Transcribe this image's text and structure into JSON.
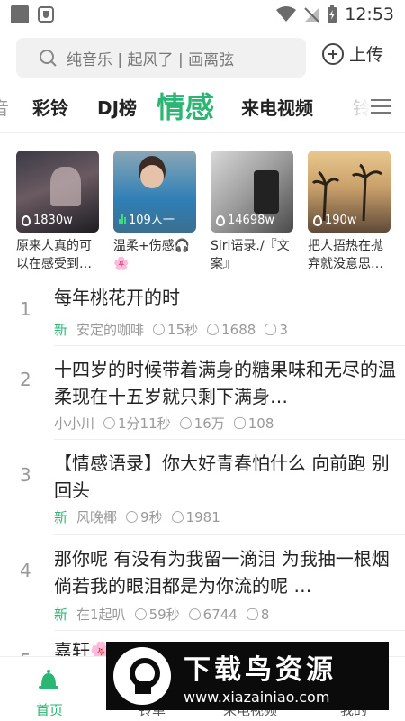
{
  "status": {
    "time": "12:53"
  },
  "search": {
    "placeholder": "纯音乐 | 起风了 | 画离弦",
    "upload_label": "上传"
  },
  "tabs": [
    {
      "label": "音"
    },
    {
      "label": "彩铃"
    },
    {
      "label": "DJ榜"
    },
    {
      "label": "情感",
      "active": true
    },
    {
      "label": "来电视频"
    },
    {
      "label": "铃"
    }
  ],
  "cards": [
    {
      "plays": "1830w",
      "title": "原来人真的可以在感受到…"
    },
    {
      "plays": "109人一",
      "title": "温柔+伤感🎧🌸"
    },
    {
      "plays": "14698w",
      "title": "Siri语录./『文案』"
    },
    {
      "plays": "190w",
      "title": "把人捂热在抛弃就没意思…"
    }
  ],
  "list": [
    {
      "rank": "1",
      "title": "每年桃花开的时",
      "is_new": true,
      "new_label": "新",
      "author": "安定的咖啡",
      "duration": "15秒",
      "likes": "1688",
      "comments": "3"
    },
    {
      "rank": "2",
      "title": "十四岁的时候带着满身的糖果味和无尽的温柔现在十五岁就只剩下满身…",
      "is_new": false,
      "new_label": "",
      "author": "小小川",
      "duration": "1分11秒",
      "likes": "16万",
      "comments": "108"
    },
    {
      "rank": "3",
      "title": "【情感语录】你大好青春怕什么 向前跑 别回头",
      "is_new": true,
      "new_label": "新",
      "author": "风晚椰",
      "duration": "9秒",
      "likes": "1981",
      "comments": ""
    },
    {
      "rank": "4",
      "title": "那你呢 有没有为我留一滴泪 为我抽一根烟 倘若我的眼泪都是为你流的呢 …",
      "is_new": true,
      "new_label": "新",
      "author": "在1起叭",
      "duration": "59秒",
      "likes": "6744",
      "comments": "8"
    },
    {
      "rank": "5",
      "title": "嘉轩🌸",
      "is_new": false,
      "new_label": "",
      "author": "",
      "duration": "",
      "likes": "",
      "comments": ""
    }
  ],
  "bottom_nav": [
    {
      "label": "首页",
      "active": true
    },
    {
      "label": "铃单"
    },
    {
      "label": "来电视频"
    },
    {
      "label": "我的"
    }
  ],
  "watermark": {
    "title": "下载鸟资源",
    "url": "www.xiazainiao.com"
  },
  "colors": {
    "accent": "#2bb673"
  }
}
